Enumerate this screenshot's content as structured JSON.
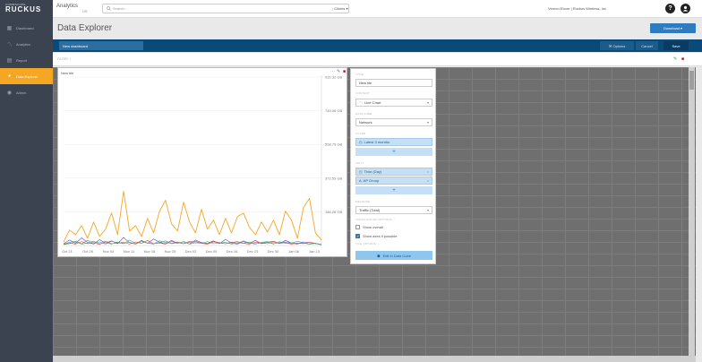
{
  "sidebar": {
    "logo_small": "COMMSCOPE",
    "logo_big": "RUCKUS",
    "items": [
      {
        "label": "Dashboard",
        "icon": "dashboard-icon"
      },
      {
        "label": "Analytics",
        "icon": "analytics-icon"
      },
      {
        "label": "Report",
        "icon": "report-icon"
      },
      {
        "label": "Data Explorer",
        "icon": "data-explorer-icon"
      },
      {
        "label": "Admin",
        "icon": "admin-icon"
      }
    ],
    "active_index": 3
  },
  "topbar": {
    "app_name": "Analytics",
    "app_region": "US",
    "search_placeholder": "Search...",
    "clients_label": "Clients",
    "user_label": "Vernon Ebore | Ruckus Wireless, Inc"
  },
  "page": {
    "title": "Data Explorer",
    "download_label": "Download"
  },
  "toolbar": {
    "dashboard_placeholder": "New dashboard",
    "options_label": "Options",
    "cancel_label": "Cancel",
    "save_label": "Save"
  },
  "filter_label": "FILTER",
  "widget": {
    "title": "New tile",
    "chart_data": {
      "type": "line",
      "x": [
        "Oct 21",
        "Oct 28",
        "Nov 04",
        "Nov 11",
        "Nov 18",
        "Nov 25",
        "Dec 02",
        "Dec 09",
        "Dec 16",
        "Dec 23",
        "Dec 30",
        "Jan 06",
        "Jan 13"
      ],
      "y_tick_labels": [
        "931.32 GB",
        "745.06 GB",
        "558.79 GB",
        "372.53 GB",
        "186.26 GB"
      ],
      "ylim": [
        0,
        931.32
      ],
      "y_unit": "GB",
      "series": [
        {
          "color": "#f5a623",
          "values": [
            20,
            85,
            60,
            110,
            40,
            130,
            50,
            90,
            180,
            60,
            300,
            80,
            110,
            50,
            150,
            70,
            190,
            250,
            120,
            80,
            240,
            130,
            70,
            200,
            90,
            140,
            60,
            150,
            70,
            160,
            180,
            100,
            60,
            130,
            75,
            140,
            60,
            190,
            140,
            40,
            210,
            260,
            70,
            30
          ]
        },
        {
          "color": "#6a4ab5",
          "values": [
            10,
            30,
            12,
            42,
            18,
            8,
            32,
            14,
            26,
            10,
            44,
            16,
            8,
            28,
            12,
            36,
            18,
            10,
            28,
            12,
            22,
            8,
            30,
            16,
            12,
            26,
            10,
            34,
            14,
            8,
            22,
            12,
            28,
            10,
            18,
            24,
            10,
            28,
            14,
            8,
            20,
            16,
            10,
            6
          ]
        },
        {
          "color": "#4a90d9",
          "values": [
            8,
            18,
            24,
            10,
            28,
            14,
            20,
            8,
            24,
            16,
            10,
            30,
            12,
            22,
            14,
            8,
            26,
            18,
            12,
            20,
            10,
            24,
            14,
            18,
            8,
            22,
            16,
            10,
            20,
            12,
            26,
            14,
            8,
            18,
            22,
            10,
            16,
            20,
            12,
            24,
            14,
            8,
            12,
            6
          ]
        },
        {
          "color": "#e8463a",
          "values": [
            6,
            14,
            8,
            22,
            10,
            16,
            6,
            24,
            10,
            14,
            18,
            8,
            20,
            12,
            28,
            10,
            14,
            8,
            22,
            16,
            10,
            18,
            24,
            12,
            8,
            20,
            14,
            10,
            16,
            22,
            12,
            8,
            18,
            14,
            10,
            20,
            12,
            16,
            8,
            14,
            10,
            18,
            12,
            4
          ]
        },
        {
          "color": "#4cae4c",
          "values": [
            5,
            10,
            20,
            8,
            14,
            24,
            10,
            16,
            8,
            20,
            12,
            18,
            8,
            22,
            14,
            10,
            16,
            26,
            10,
            14,
            20,
            8,
            16,
            12,
            22,
            10,
            14,
            18,
            8,
            16,
            12,
            20,
            10,
            14,
            18,
            8,
            22,
            12,
            16,
            10,
            14,
            8,
            12,
            4
          ]
        }
      ]
    }
  },
  "panel": {
    "title_label": "TITLE",
    "title_value": "New tile",
    "content_label": "CONTENT",
    "content_value": "Line Chart",
    "datacube_label": "DATA CUBE",
    "datacube_value": "Network",
    "filter_label": "FILTER",
    "filter_value": "Latest 3 months",
    "split_label": "SPLIT",
    "split_values": [
      "Time (Day)",
      "AP Group"
    ],
    "measure_label": "MEASURE",
    "measure_value": "Traffic (Total)",
    "viz_options_label": "VISUALIZATION OPTIONS",
    "show_overall": "Show overall",
    "show_axes": "Show axes if possible",
    "tile_options_label": "TILE OPTIONS",
    "edit_button": "Edit in Data Cube"
  }
}
